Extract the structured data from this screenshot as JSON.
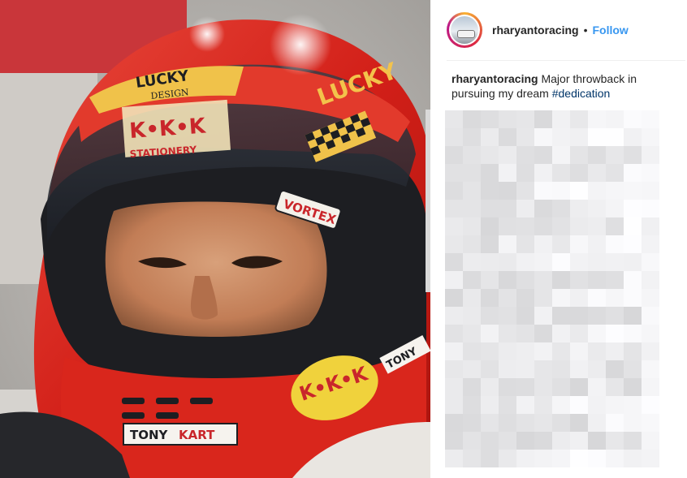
{
  "post": {
    "username": "rharyantoracing",
    "separator": "•",
    "follow_label": "Follow",
    "caption_user": "rharyantoracing",
    "caption_text": "Major throwback in pursuing my dream",
    "caption_hashtag": "#dedication"
  },
  "photo": {
    "visor_brand": "LUCKY",
    "visor_sub": "DESIGN",
    "visor_sticker": "K•K•K",
    "visor_sticker_sub": "STATIONERY",
    "visor_right_text": "LUCKY",
    "side_sticker": "VORTEX",
    "chin_sticker": "K•K•K",
    "chin_logo": "TONY",
    "chin_logo_b": "KART",
    "right_side_text": "TONY"
  },
  "colors": {
    "accent": "#3897f0",
    "helmet_red": "#d9261c"
  }
}
